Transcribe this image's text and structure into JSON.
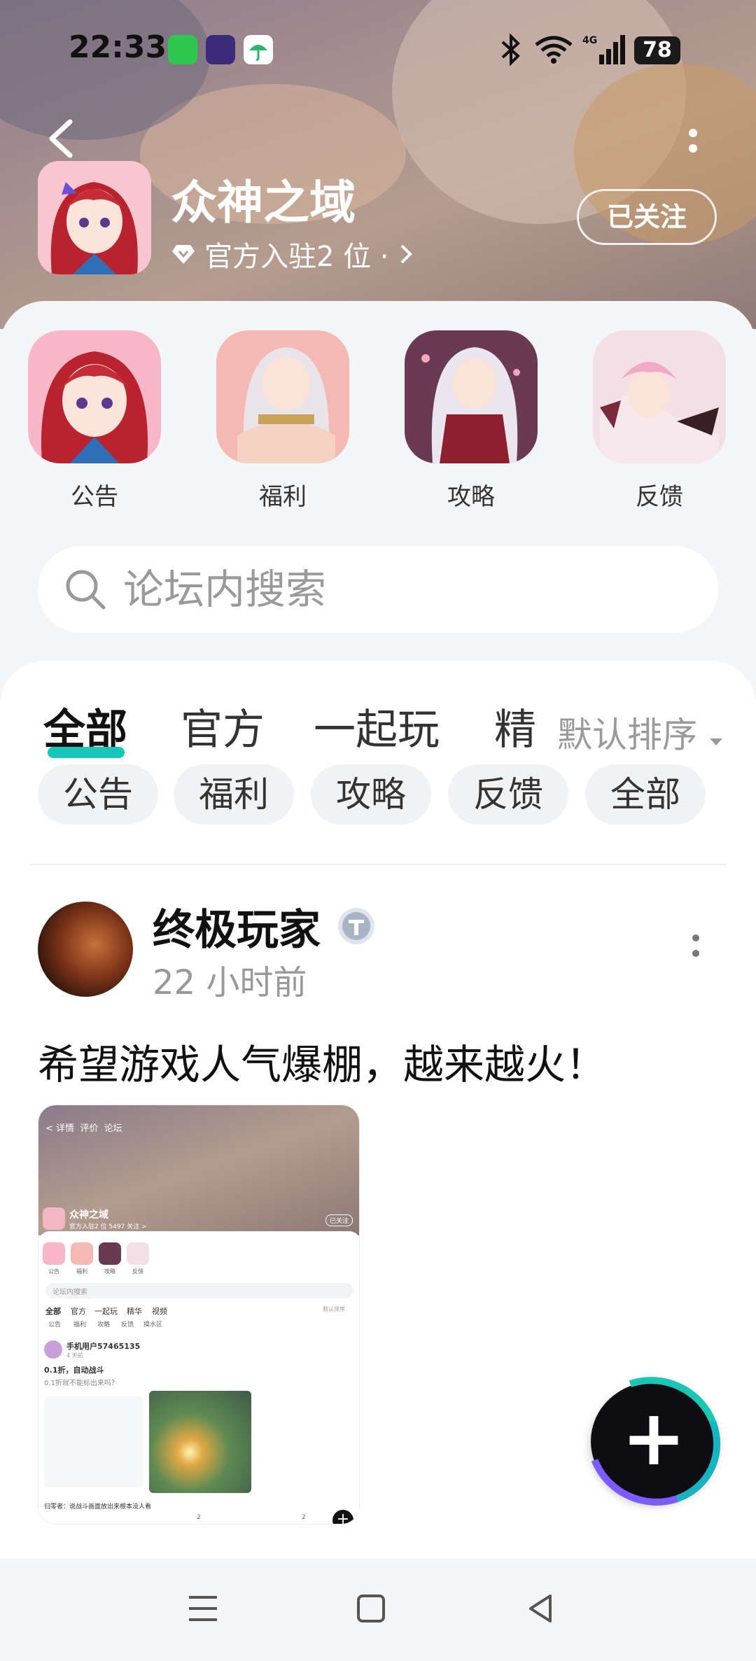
{
  "status_bar": {
    "time": "22:33",
    "battery": "78"
  },
  "header": {
    "title": "众神之域",
    "subtitle": "官方入驻2 位 ·",
    "follow_label": "已关注"
  },
  "shortcuts": [
    {
      "label": "公告"
    },
    {
      "label": "福利"
    },
    {
      "label": "攻略"
    },
    {
      "label": "反馈"
    }
  ],
  "search": {
    "placeholder": "论坛内搜索"
  },
  "tabs": [
    {
      "label": "全部",
      "active": true
    },
    {
      "label": "官方"
    },
    {
      "label": "一起玩"
    },
    {
      "label": "精"
    }
  ],
  "sort_label": "默认排序",
  "chips": [
    "公告",
    "福利",
    "攻略",
    "反馈",
    "全部"
  ],
  "post": {
    "author": "终极玩家",
    "time": "22 小时前",
    "text": "希望游戏人气爆棚，越来越火！",
    "screenshot": {
      "tabs_top": [
        "详情",
        "评价",
        "论坛"
      ],
      "title": "众神之域",
      "subtitle": "官方入驻2 位  5497 关注 >",
      "follow": "已关注",
      "shortcuts": [
        "公告",
        "福利",
        "攻略",
        "反馈"
      ],
      "search": "论坛内搜索",
      "tabs": [
        "全部",
        "官方",
        "一起玩",
        "精华",
        "视频"
      ],
      "sort": "默认排序",
      "chips": [
        "公告",
        "福利",
        "攻略",
        "反馈",
        "摸水区"
      ],
      "user": "手机用户57465135",
      "user_time": "4 天前",
      "post_title": "0.1折，自动战斗",
      "post_body": "0.1折就不能标出来吗？",
      "reply": "归零者：说战斗画面放出来根本没人看",
      "comments": "2",
      "likes": "2"
    }
  },
  "fab_label": "+",
  "colors": {
    "accent": "#17c8b8",
    "chip_bg": "#f1f2f4"
  }
}
